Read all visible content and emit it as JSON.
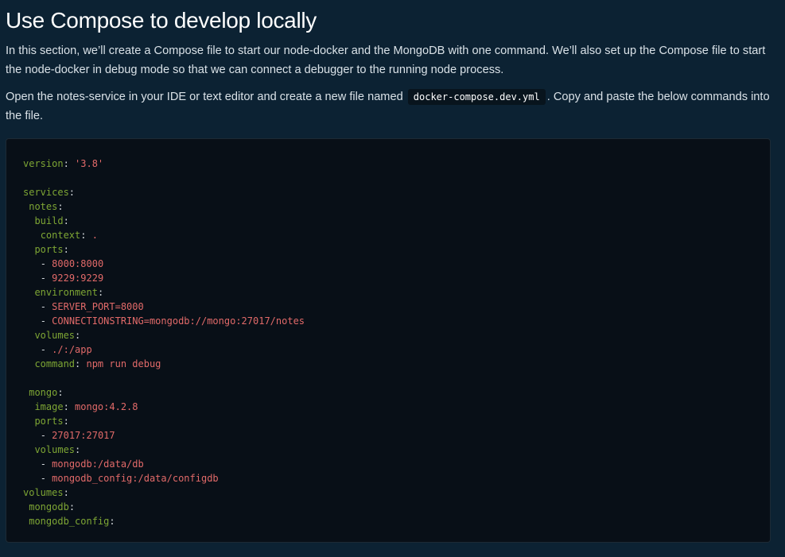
{
  "heading": "Use Compose to develop locally",
  "intro": {
    "paragraph1": "In this section, we’ll create a Compose file to start our node-docker and the MongoDB with one command. We’ll also set up the Compose file to start the node-docker in debug mode so that we can connect a debugger to the running node process.",
    "paragraph2_before": "Open the notes-service in your IDE or text editor and create a new file named",
    "paragraph2_code": "docker-compose.dev.yml",
    "paragraph2_after": ". Copy and paste the below commands into the file."
  },
  "code_block": {
    "lines": [
      {
        "indent": "",
        "key": "version",
        "sep": ": ",
        "value": "'3.8'"
      },
      {
        "indent": "",
        "key": "",
        "sep": "",
        "value": ""
      },
      {
        "indent": "",
        "key": "services",
        "sep": ":",
        "value": ""
      },
      {
        "indent": " ",
        "key": "notes",
        "sep": ":",
        "value": ""
      },
      {
        "indent": "  ",
        "key": "build",
        "sep": ":",
        "value": ""
      },
      {
        "indent": "   ",
        "key": "context",
        "sep": ": ",
        "value": "."
      },
      {
        "indent": "  ",
        "key": "ports",
        "sep": ":",
        "value": ""
      },
      {
        "indent": "   ",
        "key": "",
        "sep": "- ",
        "value": "8000:8000"
      },
      {
        "indent": "   ",
        "key": "",
        "sep": "- ",
        "value": "9229:9229"
      },
      {
        "indent": "  ",
        "key": "environment",
        "sep": ":",
        "value": ""
      },
      {
        "indent": "   ",
        "key": "",
        "sep": "- ",
        "value": "SERVER_PORT=8000"
      },
      {
        "indent": "   ",
        "key": "",
        "sep": "- ",
        "value": "CONNECTIONSTRING=mongodb://mongo:27017/notes"
      },
      {
        "indent": "  ",
        "key": "volumes",
        "sep": ":",
        "value": ""
      },
      {
        "indent": "   ",
        "key": "",
        "sep": "- ",
        "value": "./:/app"
      },
      {
        "indent": "  ",
        "key": "command",
        "sep": ": ",
        "value": "npm run debug"
      },
      {
        "indent": "",
        "key": "",
        "sep": "",
        "value": ""
      },
      {
        "indent": " ",
        "key": "mongo",
        "sep": ":",
        "value": ""
      },
      {
        "indent": "  ",
        "key": "image",
        "sep": ": ",
        "value": "mongo:4.2.8"
      },
      {
        "indent": "  ",
        "key": "ports",
        "sep": ":",
        "value": ""
      },
      {
        "indent": "   ",
        "key": "",
        "sep": "- ",
        "value": "27017:27017"
      },
      {
        "indent": "  ",
        "key": "volumes",
        "sep": ":",
        "value": ""
      },
      {
        "indent": "   ",
        "key": "",
        "sep": "- ",
        "value": "mongodb:/data/db"
      },
      {
        "indent": "   ",
        "key": "",
        "sep": "- ",
        "value": "mongodb_config:/data/configdb"
      },
      {
        "indent": "",
        "key": "volumes",
        "sep": ":",
        "value": ""
      },
      {
        "indent": " ",
        "key": "mongodb",
        "sep": ":",
        "value": ""
      },
      {
        "indent": " ",
        "key": "mongodb_config",
        "sep": ":",
        "value": ""
      }
    ]
  },
  "colors": {
    "background": "#0c2233",
    "code_background": "#080f17",
    "yaml_key": "#7ea634",
    "yaml_value": "#e26a69",
    "punctuation": "#d3d8dc"
  }
}
